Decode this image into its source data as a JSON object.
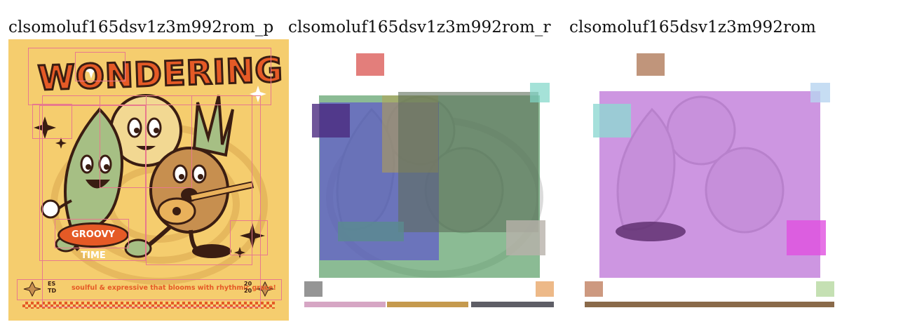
{
  "captions": {
    "p": "clsomoluf165dsv1z3m992rom_p",
    "r": "clsomoluf165dsv1z3m992rom_r",
    "base": "clsomoluf165dsv1z3m992rom"
  },
  "poster": {
    "title": "WONDERING",
    "badge": "GROOVY TIME",
    "es": "ES TD",
    "tagline": "soulful & expressive that blooms with rhythmic grace!",
    "year": "20 20"
  },
  "colors": {
    "poster_bg": "#f5cd6e",
    "accent_orange": "#e55a26",
    "outline": "#3a1d12",
    "leaf_green": "#a6bf84",
    "sun_yellow": "#f2d892",
    "pineapple_brown": "#c78f4f",
    "overlay_blue": "#5b4fcf",
    "overlay_green": "#5a9e67",
    "overlay_purple": "#b86ad4",
    "overlay_red": "#d9534f",
    "overlay_teal": "#7fd6c7"
  },
  "icons": [
    "sparkle-icon",
    "sparkle-icon",
    "sparkle-icon"
  ]
}
